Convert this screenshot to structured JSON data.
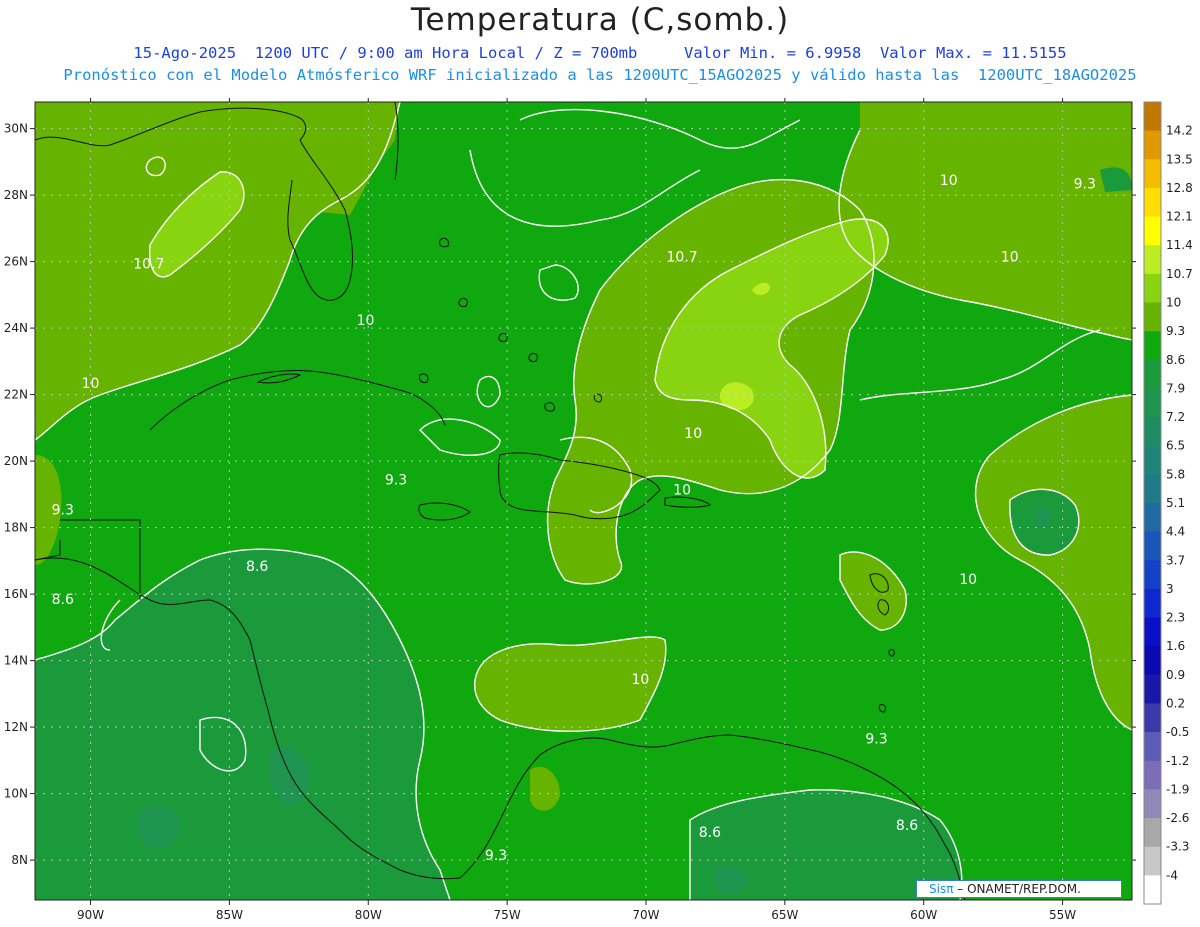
{
  "header": {
    "title": "Temperatura (C,somb.)",
    "subtitle_line1": "15-Ago-2025  1200 UTC / 9:00 am Hora Local / Z = 700mb     Valor Min. = 6.9958  Valor Max. = 11.5155",
    "subtitle_line2": "Pronóstico con el Modelo Atmósferico WRF inicializado a las 1200UTC_15AGO2025 y válido hasta las  1200UTC_18AGO2025"
  },
  "map": {
    "lon_range": [
      -92,
      -52.5
    ],
    "lat_range": [
      6.8,
      30.8
    ],
    "lon_ticks": [
      {
        "value": -90,
        "label": "90W"
      },
      {
        "value": -85,
        "label": "85W"
      },
      {
        "value": -80,
        "label": "80W"
      },
      {
        "value": -75,
        "label": "75W"
      },
      {
        "value": -70,
        "label": "70W"
      },
      {
        "value": -65,
        "label": "65W"
      },
      {
        "value": -60,
        "label": "60W"
      },
      {
        "value": -55,
        "label": "55W"
      }
    ],
    "lat_ticks": [
      {
        "value": 8,
        "label": "8N"
      },
      {
        "value": 10,
        "label": "10N"
      },
      {
        "value": 12,
        "label": "12N"
      },
      {
        "value": 14,
        "label": "14N"
      },
      {
        "value": 16,
        "label": "16N"
      },
      {
        "value": 18,
        "label": "18N"
      },
      {
        "value": 20,
        "label": "20N"
      },
      {
        "value": 22,
        "label": "22N"
      },
      {
        "value": 24,
        "label": "24N"
      },
      {
        "value": 26,
        "label": "26N"
      },
      {
        "value": 28,
        "label": "28N"
      },
      {
        "value": 30,
        "label": "30N"
      }
    ],
    "contour_labels": [
      {
        "text": "10.7",
        "lon": -87.9,
        "lat": 25.8
      },
      {
        "text": "10.7",
        "lon": -68.7,
        "lat": 26.0
      },
      {
        "text": "10",
        "lon": -59.1,
        "lat": 28.3
      },
      {
        "text": "9.3",
        "lon": -54.2,
        "lat": 28.2
      },
      {
        "text": "10",
        "lon": -56.9,
        "lat": 26.0
      },
      {
        "text": "10",
        "lon": -80.1,
        "lat": 24.1
      },
      {
        "text": "10",
        "lon": -90.0,
        "lat": 22.2
      },
      {
        "text": "10",
        "lon": -68.3,
        "lat": 20.7
      },
      {
        "text": "9.3",
        "lon": -79.0,
        "lat": 19.3
      },
      {
        "text": "10",
        "lon": -68.7,
        "lat": 19.0
      },
      {
        "text": "9.3",
        "lon": -91.0,
        "lat": 18.4
      },
      {
        "text": "8.6",
        "lon": -84.0,
        "lat": 16.7
      },
      {
        "text": "10",
        "lon": -58.4,
        "lat": 16.3
      },
      {
        "text": "8.6",
        "lon": -91.0,
        "lat": 15.7
      },
      {
        "text": "10",
        "lon": -70.2,
        "lat": 13.3
      },
      {
        "text": "9.3",
        "lon": -61.7,
        "lat": 11.5
      },
      {
        "text": "8.6",
        "lon": -67.7,
        "lat": 8.7
      },
      {
        "text": "8.6",
        "lon": -60.6,
        "lat": 8.9
      },
      {
        "text": "9.3",
        "lon": -75.4,
        "lat": 8.0
      }
    ]
  },
  "colorbar": {
    "labels": [
      "14.2",
      "13.5",
      "12.8",
      "12.1",
      "11.4",
      "10.7",
      "10",
      "9.3",
      "8.6",
      "7.9",
      "7.2",
      "6.5",
      "5.8",
      "5.1",
      "4.4",
      "3.7",
      "3",
      "2.3",
      "1.6",
      "0.9",
      "0.2",
      "-0.5",
      "-1.2",
      "-1.9",
      "-2.6",
      "-3.3",
      "-4"
    ],
    "colors": [
      "#c07800",
      "#e09a00",
      "#f5bd00",
      "#ffdd00",
      "#ffff00",
      "#bbee22",
      "#88d410",
      "#66b400",
      "#0fa80f",
      "#1a9a3a",
      "#1e9450",
      "#1e8d64",
      "#1f8578",
      "#207a8a",
      "#1f6aa0",
      "#1a55b8",
      "#1540c8",
      "#0f28d0",
      "#0a10c8",
      "#0a0ab0",
      "#1818a8",
      "#3a3aaa",
      "#5c5cb8",
      "#7d6cb8",
      "#9088b8",
      "#a8a8a8",
      "#c8c8c8",
      "#ffffff"
    ]
  },
  "credit": {
    "brand": "Sisπ",
    "text": "– ONAMET/REP.DOM."
  }
}
